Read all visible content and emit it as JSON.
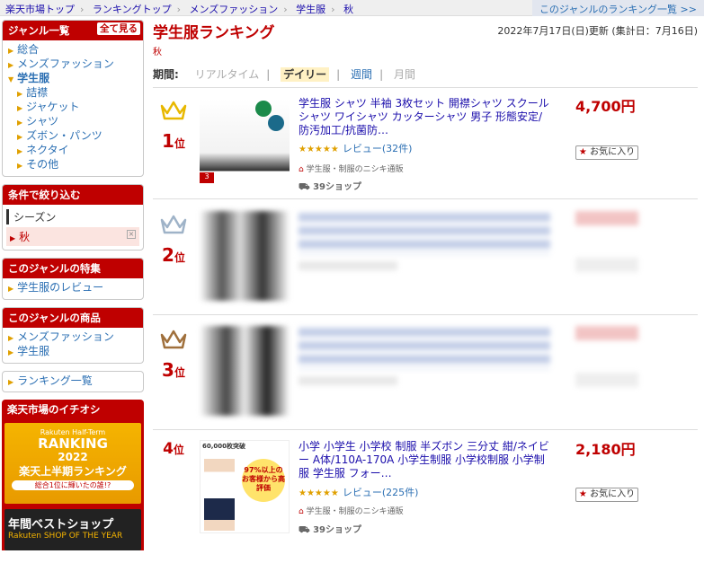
{
  "breadcrumb": [
    "楽天市場トップ",
    "ランキングトップ",
    "メンズファッション",
    "学生服",
    "秋"
  ],
  "all_rankings_link": "このジャンルのランキング一覧 >>",
  "sidebar": {
    "genre_title": "ジャンル一覧",
    "show_all": "全て見る",
    "genres": [
      "総合",
      "メンズファッション",
      "学生服",
      "詰襟",
      "ジャケット",
      "シャツ",
      "ズボン・パンツ",
      "ネクタイ",
      "その他"
    ],
    "filter_title": "条件で絞り込む",
    "filter_group": "シーズン",
    "filter_selected": "秋",
    "feature_title": "このジャンルの特集",
    "feature_link": "学生服のレビュー",
    "products_title": "このジャンルの商品",
    "product_links": [
      "メンズファッション",
      "学生服"
    ],
    "ranking_list_link": "ランキング一覧",
    "recommend_title": "楽天市場のイチオシ",
    "banner1": {
      "top": "Rakuten Half-Term",
      "main": "RANKING",
      "year": "2022",
      "jp": "楽天上半期ランキング",
      "sub": "総合1位に輝いたの誰!?"
    },
    "banner2": {
      "jp": "年間ベストショップ",
      "en": "Rakuten SHOP OF THE YEAR"
    }
  },
  "main": {
    "title": "学生服ランキング",
    "category": "秋",
    "updated": "2022年7月17日(日)更新 (集計日：7月16日)",
    "period_label": "期間:",
    "periods": [
      "リアルタイム",
      "デイリー",
      "週間",
      "月間"
    ]
  },
  "items": [
    {
      "rank": "1",
      "rank_suffix": "位",
      "name": "学生服 シャツ 半袖 3枚セット 開襟シャツ スクールシャツ ワイシャツ カッターシャツ 男子 形態安定/防汚加工/抗菌防…",
      "price": "4,700円",
      "stars": "★★★★★",
      "reviews": "レビュー(32件)",
      "shop": "学生服・制服のニシキ通販",
      "shop_count": "39ショップ",
      "fav": "お気に入り"
    },
    {
      "rank": "2",
      "rank_suffix": "位"
    },
    {
      "rank": "3",
      "rank_suffix": "位"
    },
    {
      "rank": "4",
      "rank_suffix": "位",
      "name": "小学 小学生 小学校 制服 半ズボン 三分丈 紺/ネイビー A体/110A-170A 小学生制服 小学校制服 小学制服 学生服 フォー…",
      "price": "2,180円",
      "stars": "★★★★★",
      "reviews": "レビュー(225件)",
      "shop": "学生服・制服のニシキ通販",
      "shop_count": "39ショップ",
      "fav": "お気に入り",
      "thumb_badge": "60,000枚突破",
      "thumb_text": "97%以上のお客様から高評価"
    }
  ]
}
